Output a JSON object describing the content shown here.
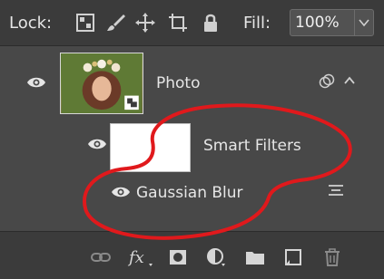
{
  "lockbar": {
    "lock_label": "Lock:",
    "lock_icons": [
      "lock-transparent-pixels-icon",
      "lock-image-pixels-icon",
      "lock-position-icon",
      "lock-artboard-icon",
      "lock-all-icon"
    ],
    "fill_label": "Fill:",
    "fill_value": "100%"
  },
  "layers": {
    "photo": {
      "name": "Photo",
      "visible": true
    },
    "smart_filters": {
      "name": "Smart Filters",
      "visible": true
    },
    "gaussian_blur": {
      "name": "Gaussian Blur",
      "visible": true
    }
  },
  "bottom_icons": [
    "link-layers-icon",
    "fx-icon",
    "add-mask-icon",
    "adjustment-layer-icon",
    "new-group-icon",
    "new-layer-icon",
    "delete-layer-icon"
  ],
  "bottom_fx_label": "fx",
  "colors": {
    "panel_bg": "#3b3b3b",
    "layer_bg": "#484848",
    "text": "#e6e6e6",
    "annotation_red": "#e0191c"
  }
}
